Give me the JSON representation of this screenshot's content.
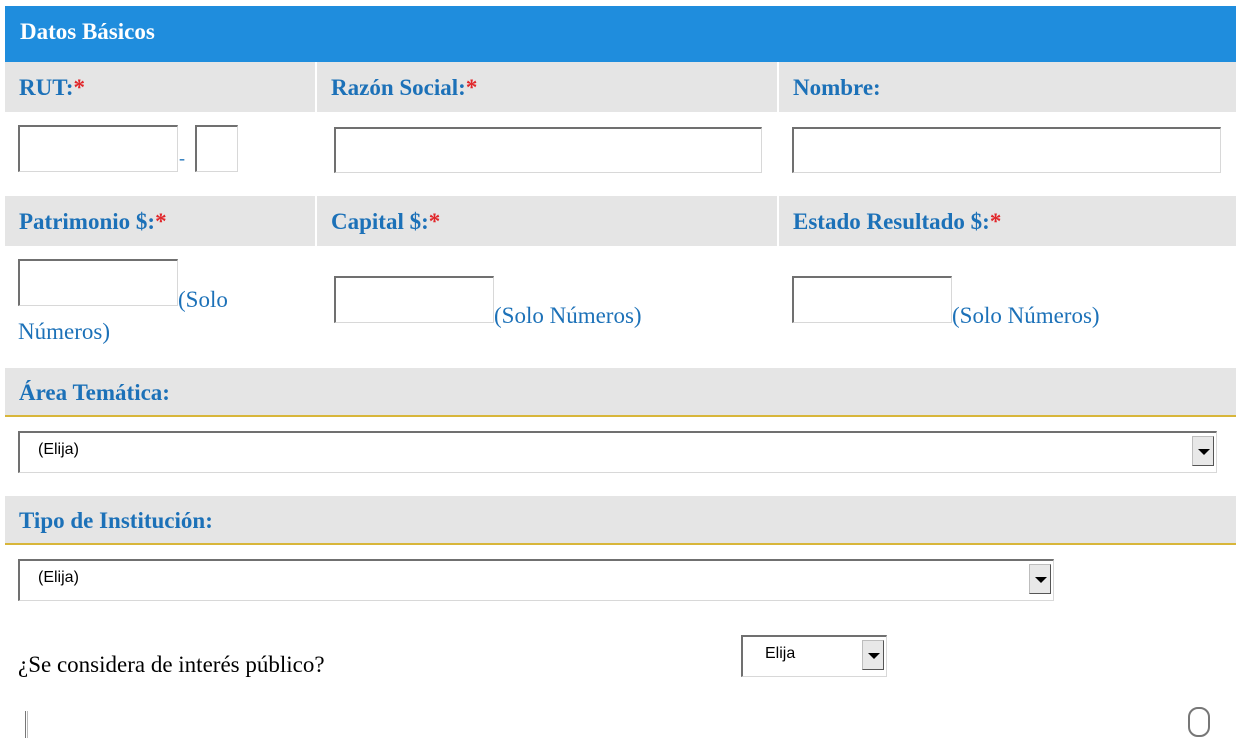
{
  "header": {
    "title": "Datos Básicos"
  },
  "labels": {
    "rut": "RUT:",
    "razon_social": "Razón Social:",
    "nombre": "Nombre:",
    "patrimonio": "Patrimonio $:",
    "capital": "Capital $:",
    "estado_resultado": "Estado Resultado $:",
    "required_mark": "*",
    "rut_separator": "-"
  },
  "inputs": {
    "rut_number": "",
    "rut_dv": "",
    "razon_social": "",
    "nombre": "",
    "patrimonio": "",
    "capital": "",
    "estado_resultado": ""
  },
  "hints": {
    "patrimonio_line1": "(Solo",
    "patrimonio_line2": "Números)",
    "capital": "(Solo Números)",
    "estado_resultado": "(Solo Números)"
  },
  "area_tematica": {
    "label": "Área Temática:",
    "selected": "(Elija)"
  },
  "tipo_institucion": {
    "label": "Tipo de Institución:",
    "selected": "(Elija)"
  },
  "interes_publico": {
    "question": "¿Se considera de interés público?",
    "selected": "Elija"
  }
}
